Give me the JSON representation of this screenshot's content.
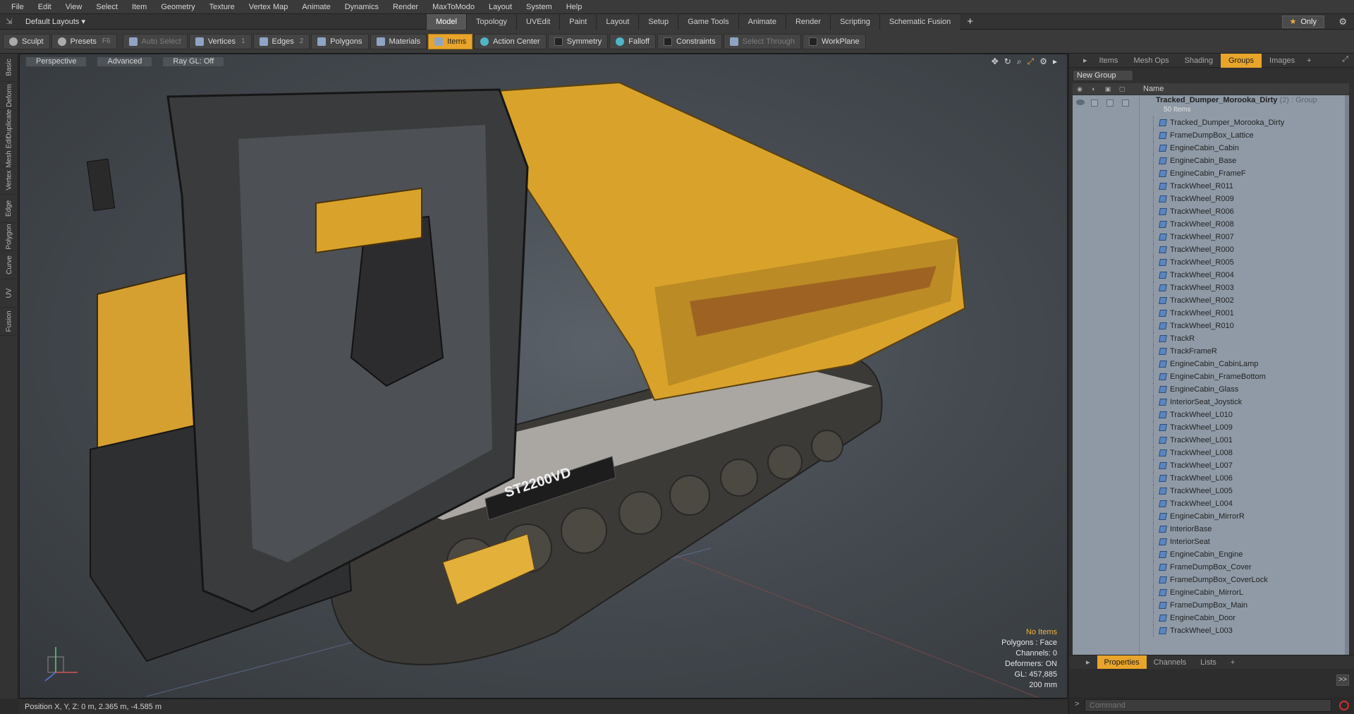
{
  "menu": [
    "File",
    "Edit",
    "View",
    "Select",
    "Item",
    "Geometry",
    "Texture",
    "Vertex Map",
    "Animate",
    "Dynamics",
    "Render",
    "MaxToModo",
    "Layout",
    "System",
    "Help"
  ],
  "layouts_label": "Default Layouts ▾",
  "tabs": [
    "Model",
    "Topology",
    "UVEdit",
    "Paint",
    "Layout",
    "Setup",
    "Game Tools",
    "Animate",
    "Render",
    "Scripting",
    "Schematic Fusion"
  ],
  "active_tab": "Model",
  "only_label": "Only",
  "toolbar": {
    "sculpt": "Sculpt",
    "presets": "Presets",
    "presets_key": "F6",
    "auto_select": "Auto Select",
    "vertices": "Vertices",
    "vertices_count": "1",
    "edges": "Edges",
    "edges_count": "2",
    "polygons": "Polygons",
    "materials": "Materials",
    "items": "Items",
    "action_center": "Action Center",
    "symmetry": "Symmetry",
    "falloff": "Falloff",
    "constraints": "Constraints",
    "select_through": "Select Through",
    "workplane": "WorkPlane"
  },
  "left_tabs": [
    "Basic",
    "Deform",
    "Duplicate",
    "Mesh Edit",
    "Vertex",
    "Edge",
    "Polygon",
    "Curve",
    "UV",
    "Fusion"
  ],
  "viewport": {
    "perspective": "Perspective",
    "advanced": "Advanced",
    "raygl": "Ray GL: Off",
    "info": {
      "no_items": "No Items",
      "polygons": "Polygons : Face",
      "channels": "Channels: 0",
      "deformers": "Deformers: ON",
      "gl": "GL: 457,885",
      "scale": "200 mm"
    },
    "decal_text": "ST2200VD"
  },
  "status": "Position X, Y, Z:  0 m, 2.365 m, -4.585 m",
  "right_panel": {
    "tabs": [
      "Items",
      "Mesh Ops",
      "Shading",
      "Groups",
      "Images"
    ],
    "active_tab": "Groups",
    "new_group": "New Group",
    "name_header": "Name",
    "group_name": "Tracked_Dumper_Morooka_Dirty",
    "group_count": "(2)",
    "group_type": ": Group",
    "group_sub": "50 Items",
    "items": [
      "Tracked_Dumper_Morooka_Dirty",
      "FrameDumpBox_Lattice",
      "EngineCabin_Cabin",
      "EngineCabin_Base",
      "EngineCabin_FrameF",
      "TrackWheel_R011",
      "TrackWheel_R009",
      "TrackWheel_R006",
      "TrackWheel_R008",
      "TrackWheel_R007",
      "TrackWheel_R000",
      "TrackWheel_R005",
      "TrackWheel_R004",
      "TrackWheel_R003",
      "TrackWheel_R002",
      "TrackWheel_R001",
      "TrackWheel_R010",
      "TrackR",
      "TrackFrameR",
      "EngineCabin_CabinLamp",
      "EngineCabin_FrameBottom",
      "EngineCabin_Glass",
      "InteriorSeat_Joystick",
      "TrackWheel_L010",
      "TrackWheel_L009",
      "TrackWheel_L001",
      "TrackWheel_L008",
      "TrackWheel_L007",
      "TrackWheel_L006",
      "TrackWheel_L005",
      "TrackWheel_L004",
      "EngineCabin_MirrorR",
      "InteriorBase",
      "InteriorSeat",
      "EngineCabin_Engine",
      "FrameDumpBox_Cover",
      "FrameDumpBox_CoverLock",
      "EngineCabin_MirrorL",
      "FrameDumpBox_Main",
      "EngineCabin_Door",
      "TrackWheel_L003"
    ],
    "props_tabs": [
      "Properties",
      "Channels",
      "Lists"
    ],
    "props_active": "Properties",
    "more": ">>",
    "command_placeholder": "Command"
  },
  "colors": {
    "accent": "#e8a52a",
    "list_bg": "#8f9aa6",
    "viewport_bg": "#454b51"
  }
}
